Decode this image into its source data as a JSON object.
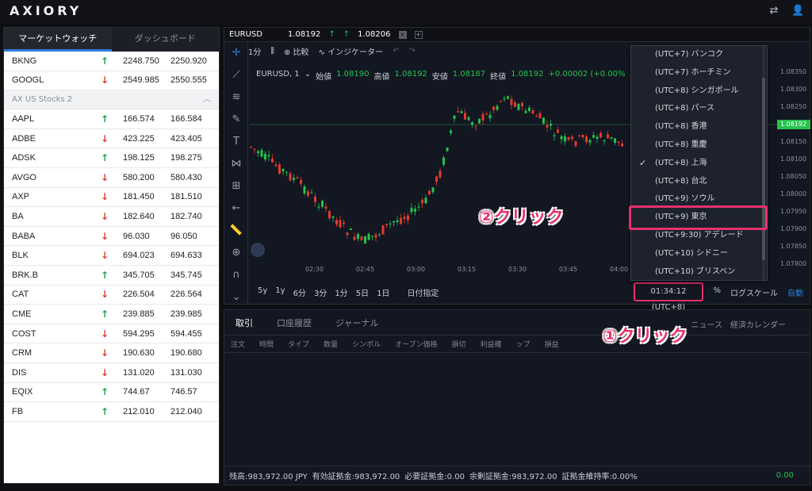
{
  "app": {
    "logo": "AXIORY"
  },
  "leftpanel": {
    "tabs": [
      {
        "label": "マーケットウォッチ"
      },
      {
        "label": "ダッシュボード"
      }
    ],
    "rows_top": [
      {
        "sym": "BKNG",
        "dir": "up",
        "bid": "2248.750",
        "ask": "2250.920"
      },
      {
        "sym": "GOOGL",
        "dir": "down",
        "bid": "2549.985",
        "ask": "2550.555"
      }
    ],
    "group": {
      "label": "AX US Stocks 2"
    },
    "rows": [
      {
        "sym": "AAPL",
        "dir": "up",
        "bid": "166.574",
        "ask": "166.584"
      },
      {
        "sym": "ADBE",
        "dir": "down",
        "bid": "423.225",
        "ask": "423.405"
      },
      {
        "sym": "ADSK",
        "dir": "up",
        "bid": "198.125",
        "ask": "198.275"
      },
      {
        "sym": "AVGO",
        "dir": "down",
        "bid": "580.200",
        "ask": "580.430"
      },
      {
        "sym": "AXP",
        "dir": "down",
        "bid": "181.450",
        "ask": "181.510"
      },
      {
        "sym": "BA",
        "dir": "down",
        "bid": "182.640",
        "ask": "182.740"
      },
      {
        "sym": "BABA",
        "dir": "down",
        "bid": "96.030",
        "ask": "96.050"
      },
      {
        "sym": "BLK",
        "dir": "down",
        "bid": "694.023",
        "ask": "694.633"
      },
      {
        "sym": "BRK.B",
        "dir": "up",
        "bid": "345.705",
        "ask": "345.745"
      },
      {
        "sym": "CAT",
        "dir": "down",
        "bid": "226.504",
        "ask": "226.564"
      },
      {
        "sym": "CME",
        "dir": "up",
        "bid": "239.885",
        "ask": "239.985"
      },
      {
        "sym": "COST",
        "dir": "down",
        "bid": "594.295",
        "ask": "594.455"
      },
      {
        "sym": "CRM",
        "dir": "down",
        "bid": "190.630",
        "ask": "190.680"
      },
      {
        "sym": "DIS",
        "dir": "down",
        "bid": "131.020",
        "ask": "131.030"
      },
      {
        "sym": "EQIX",
        "dir": "up",
        "bid": "744.67",
        "ask": "746.57"
      },
      {
        "sym": "FB",
        "dir": "up",
        "bid": "212.010",
        "ask": "212.040"
      }
    ]
  },
  "chart": {
    "tab_symbol": "EURUSD",
    "bid": "1.08192",
    "ask": "1.08206",
    "toolbar": {
      "interval": "1分",
      "compare": "比較",
      "indicator": "インジケーター"
    },
    "info": {
      "symbol": "EURUSD, 1",
      "open_label": "始値",
      "open": "1.08190",
      "high_label": "高値",
      "high": "1.08192",
      "low_label": "安値",
      "low": "1.08187",
      "close_label": "終値",
      "close": "1.08192",
      "change": "+0.00002 (+0.00%"
    },
    "time_labels": [
      "02:30",
      "02:45",
      "03:00",
      "03:15",
      "03:30",
      "03:45",
      "04:00"
    ],
    "price_labels": [
      "1.08350",
      "1.08300",
      "1.08250",
      "1.08192",
      "1.08150",
      "1.08100",
      "1.08050",
      "1.08000",
      "1.07950",
      "1.07900",
      "1.07850",
      "1.07800"
    ],
    "timeframes": [
      "5y",
      "1y",
      "6分",
      "3分",
      "1分",
      "5日",
      "1日"
    ],
    "date_jump": "日付指定",
    "clock": "01:34:12 (UTC+8)",
    "right_controls": {
      "percent": "%",
      "log": "ログスケール",
      "auto": "自動"
    }
  },
  "timezone_menu": {
    "items": [
      {
        "label": "(UTC+7) バンコク",
        "checked": false
      },
      {
        "label": "(UTC+7) ホーチミン",
        "checked": false
      },
      {
        "label": "(UTC+8) シンガポール",
        "checked": false
      },
      {
        "label": "(UTC+8) パース",
        "checked": false
      },
      {
        "label": "(UTC+8) 香港",
        "checked": false
      },
      {
        "label": "(UTC+8) 重慶",
        "checked": false
      },
      {
        "label": "(UTC+8) 上海",
        "checked": true
      },
      {
        "label": "(UTC+8) 台北",
        "checked": false
      },
      {
        "label": "(UTC+9) ソウル",
        "checked": false
      },
      {
        "label": "(UTC+9) 東京",
        "checked": false
      },
      {
        "label": "(UTC+9:30) アデレード",
        "checked": false
      },
      {
        "label": "(UTC+10) シドニー",
        "checked": false
      },
      {
        "label": "(UTC+10) ブリスベン",
        "checked": false
      }
    ]
  },
  "bottom": {
    "tabs": [
      "取引",
      "口座履歴",
      "ジャーナル"
    ],
    "right_tabs": [
      "ニュース",
      "経済カレンダー"
    ],
    "columns": [
      "注文",
      "時間",
      "タイプ",
      "数量",
      "シンボル",
      "オープン価格",
      "損切",
      "利益確",
      "ップ",
      "損益"
    ],
    "status": {
      "balance": "残高:983,972.00 JPY",
      "equity": "有効証拠金:983,972.00",
      "margin": "必要証拠金:0.00",
      "free_margin": "余剰証拠金:983,972.00",
      "margin_level": "証拠金維持率:0.00%",
      "pl": "0.00"
    }
  },
  "annotations": {
    "step1": "①クリック",
    "step2": "②クリック"
  },
  "colors": {
    "accent_pink": "#e8306b",
    "up": "#26c24d",
    "down": "#e23b2e",
    "blue": "#2e7dd7"
  }
}
